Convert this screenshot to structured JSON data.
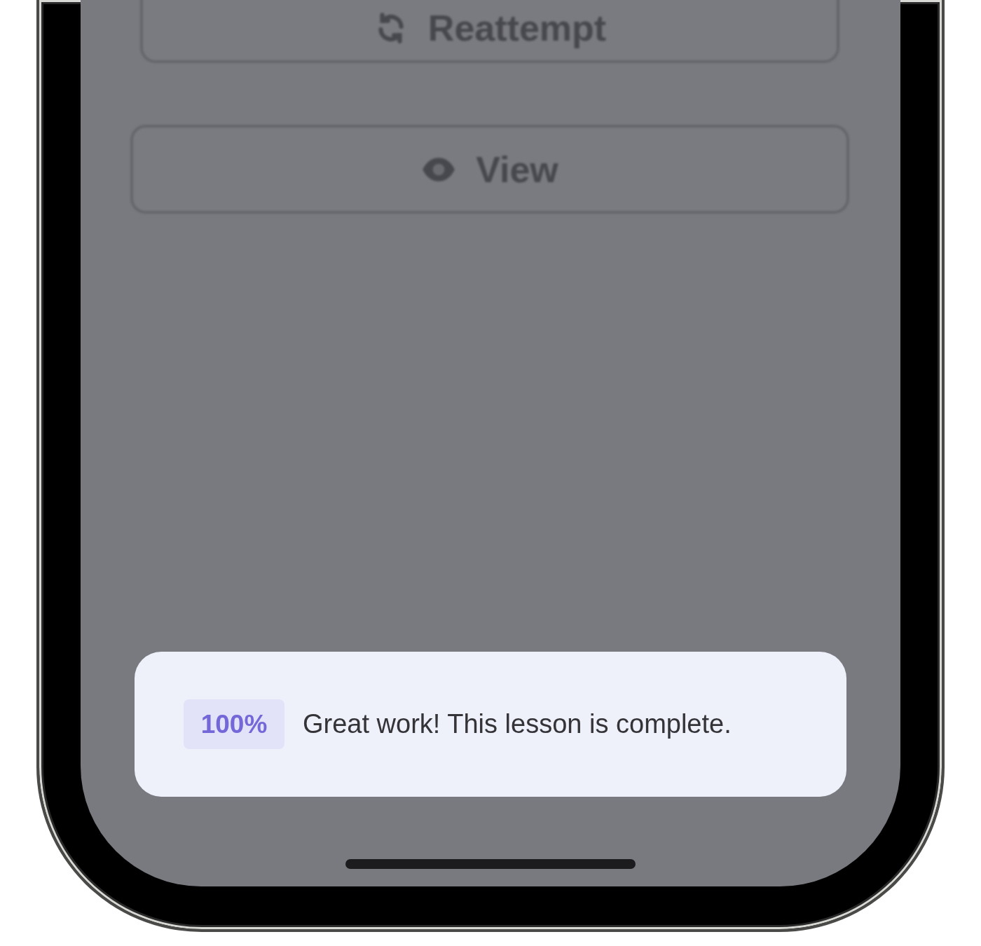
{
  "buttons": [
    {
      "label": "Reattempt",
      "kind": "reattempt"
    },
    {
      "label": "View",
      "kind": "view"
    }
  ],
  "toast": {
    "badge": "100%",
    "message": "Great work! This lesson is complete."
  }
}
